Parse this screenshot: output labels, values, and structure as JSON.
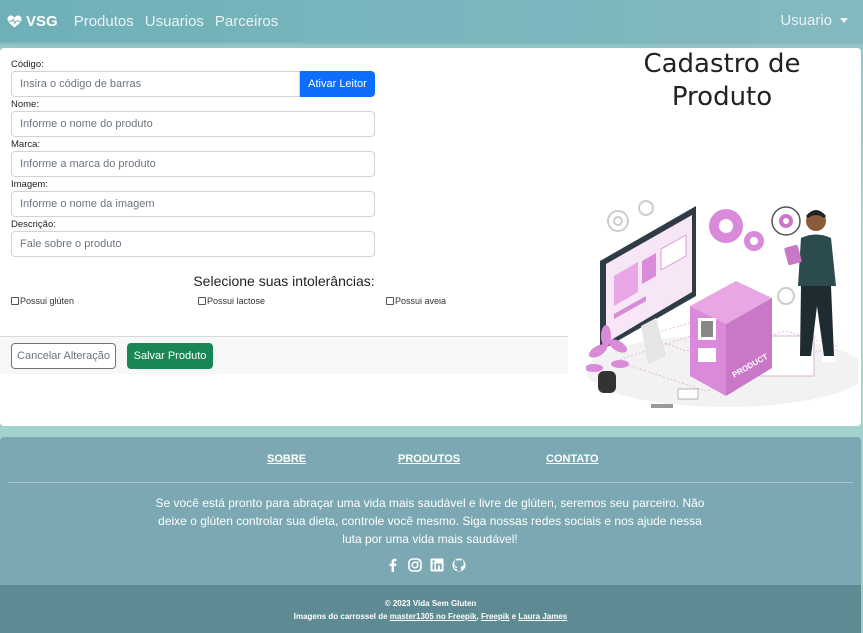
{
  "navbar": {
    "brand": "VSG",
    "links": [
      "Produtos",
      "Usuarios",
      "Parceiros"
    ],
    "user": "Usuario"
  },
  "form": {
    "codigo": {
      "label": "Código:",
      "placeholder": "Insira o código de barras",
      "button": "Ativar Leitor"
    },
    "nome": {
      "label": "Nome:",
      "placeholder": "Informe o nome do produto"
    },
    "marca": {
      "label": "Marca:",
      "placeholder": "Informe a marca do produto"
    },
    "imagem": {
      "label": "Imagem:",
      "placeholder": "Informe o nome da imagem"
    },
    "descricao": {
      "label": "Descrição:",
      "placeholder": "Fale sobre o produto"
    },
    "intolerancias_title": "Selecione suas intolerâncias:",
    "intolerancias": [
      "Possui glúten",
      "Possui lactose",
      "Possui aveia"
    ],
    "cancel_label": "Cancelar Alteração",
    "save_label": "Salvar Produto"
  },
  "page_title_line1": "Cadastro de",
  "page_title_line2": "Produto",
  "illustration": {
    "box_label": "PRODUCT"
  },
  "footer": {
    "links": [
      "SOBRE",
      "PRODUTOS",
      "CONTATO"
    ],
    "text": "Se você está pronto para abraçar uma vida mais saudável e livre de glúten, seremos seu parceiro. Não deixe o glúten controlar sua dieta, controle você mesmo. Siga nossas redes sociais e nos ajude nessa luta por uma vida mais saudável!",
    "socials": [
      "facebook-icon",
      "instagram-icon",
      "linkedin-icon",
      "github-icon"
    ],
    "copyright": "© 2023 Vida Sem Gluten",
    "credits_prefix": "Imagens do carrossel de ",
    "credit1": "master1305 no Freepik",
    "credit_sep": ", ",
    "credit2": "Freepik",
    "credit_and": " e ",
    "credit3": "Laura James"
  },
  "colors": {
    "primary": "#0d6efd",
    "success": "#198754",
    "navbar": "#7ab5bd",
    "footer": "#7ba8b2",
    "accent_pink": "#d98ad8"
  }
}
